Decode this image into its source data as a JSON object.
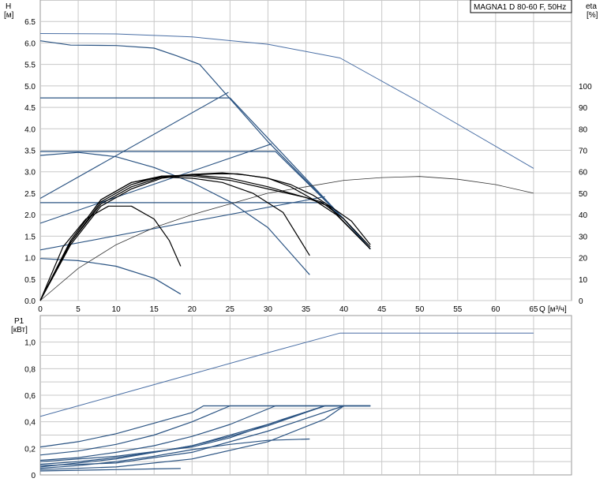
{
  "title": "MAGNA1 D 80-60 F, 50Hz",
  "chart_data": [
    {
      "type": "line",
      "name": "head-efficiency",
      "ylabel": "H",
      "yunit": "[м]",
      "y2label": "eta",
      "y2unit": "[%]",
      "xlabel": "Q",
      "xunit": "[м³/ч]",
      "xlim": [
        0,
        70
      ],
      "ylim": [
        0,
        7.0
      ],
      "y2lim": [
        0,
        140
      ],
      "xticks": [
        0,
        5,
        10,
        15,
        20,
        25,
        30,
        35,
        40,
        45,
        50,
        55,
        60,
        65
      ],
      "yticks": [
        0.0,
        0.5,
        1.0,
        1.5,
        2.0,
        2.5,
        3.0,
        3.5,
        4.0,
        4.5,
        5.0,
        5.5,
        6.0,
        6.5
      ],
      "y2ticks": [
        0,
        10,
        20,
        30,
        40,
        50,
        60,
        70,
        80,
        90,
        100
      ],
      "grid": true,
      "series": [
        {
          "curve": "head",
          "color": "#4a6fa5",
          "width": 1.0,
          "axis": "y",
          "points": [
            [
              0,
              6.22
            ],
            [
              10,
              6.21
            ],
            [
              20,
              6.14
            ],
            [
              30,
              5.97
            ],
            [
              39.5,
              5.65
            ],
            [
              50,
              4.62
            ],
            [
              65,
              3.08
            ]
          ]
        },
        {
          "curve": "head",
          "color": "#2a5382",
          "width": 1.2,
          "axis": "y",
          "points": [
            [
              0,
              6.05
            ],
            [
              4,
              5.95
            ],
            [
              10,
              5.94
            ],
            [
              15,
              5.88
            ],
            [
              18,
              5.7
            ],
            [
              21,
              5.5
            ],
            [
              30,
              3.7
            ],
            [
              40,
              1.9
            ],
            [
              43.5,
              1.2
            ]
          ]
        },
        {
          "curve": "head",
          "color": "#2a5382",
          "width": 1.2,
          "axis": "y",
          "points": [
            [
              0,
              4.72
            ],
            [
              25,
              4.72
            ],
            [
              40,
              1.9
            ],
            [
              43.5,
              1.2
            ]
          ]
        },
        {
          "curve": "head",
          "color": "#2a5382",
          "width": 1.2,
          "axis": "y",
          "points": [
            [
              0,
              3.47
            ],
            [
              31,
              3.47
            ],
            [
              40,
              1.9
            ],
            [
              43.5,
              1.2
            ]
          ]
        },
        {
          "curve": "head",
          "color": "#2a5382",
          "width": 1.2,
          "axis": "y",
          "points": [
            [
              0,
              2.28
            ],
            [
              37.5,
              2.28
            ],
            [
              40,
              1.9
            ],
            [
              43.5,
              1.2
            ]
          ]
        },
        {
          "curve": "head",
          "color": "#2a5382",
          "width": 1.2,
          "axis": "y",
          "points": [
            [
              0,
              3.38
            ],
            [
              5,
              3.45
            ],
            [
              10,
              3.35
            ],
            [
              15,
              3.1
            ],
            [
              20,
              2.75
            ],
            [
              25,
              2.3
            ],
            [
              30,
              1.7
            ],
            [
              35.5,
              0.6
            ]
          ]
        },
        {
          "curve": "head",
          "color": "#2a5382",
          "width": 1.2,
          "axis": "y",
          "points": [
            [
              0,
              0.98
            ],
            [
              5,
              0.93
            ],
            [
              10,
              0.8
            ],
            [
              15,
              0.52
            ],
            [
              18.5,
              0.15
            ]
          ]
        },
        {
          "curve": "system",
          "color": "#2a5382",
          "width": 1.1,
          "axis": "y",
          "points": [
            [
              0,
              2.38
            ],
            [
              24.8,
              4.85
            ]
          ]
        },
        {
          "curve": "system",
          "color": "#2a5382",
          "width": 1.1,
          "axis": "y",
          "points": [
            [
              0,
              1.8
            ],
            [
              30.5,
              3.65
            ]
          ]
        },
        {
          "curve": "system",
          "color": "#2a5382",
          "width": 1.1,
          "axis": "y",
          "points": [
            [
              0,
              1.18
            ],
            [
              37.5,
              2.42
            ]
          ]
        },
        {
          "curve": "efficiency",
          "color": "#333333",
          "width": 0.8,
          "axis": "y2",
          "points": [
            [
              0,
              0
            ],
            [
              5,
              15
            ],
            [
              10,
              26
            ],
            [
              15,
              34
            ],
            [
              20,
              40
            ],
            [
              25,
              45
            ],
            [
              30,
              50
            ],
            [
              35,
              53
            ],
            [
              40,
              56
            ],
            [
              45,
              57.3
            ],
            [
              50,
              57.8
            ],
            [
              55,
              56.5
            ],
            [
              60,
              54
            ],
            [
              65,
              50
            ]
          ]
        },
        {
          "curve": "efficiency",
          "color": "#000000",
          "width": 1.2,
          "axis": "y2",
          "points": [
            [
              0,
              0
            ],
            [
              4,
              26
            ],
            [
              8,
              44
            ],
            [
              12,
              52
            ],
            [
              16,
              57
            ],
            [
              20,
              58.5
            ],
            [
              23,
              59
            ],
            [
              26,
              59
            ],
            [
              30,
              57
            ],
            [
              33,
              54
            ],
            [
              36,
              49
            ],
            [
              39,
              42
            ],
            [
              41,
              37
            ],
            [
              43.5,
              26
            ]
          ]
        },
        {
          "curve": "efficiency",
          "color": "#000000",
          "width": 1.2,
          "axis": "y2",
          "points": [
            [
              0,
              0
            ],
            [
              4,
              27
            ],
            [
              8,
              45
            ],
            [
              12,
              53
            ],
            [
              16,
              57.5
            ],
            [
              20,
              58.8
            ],
            [
              24,
              59.5
            ],
            [
              27,
              58.5
            ],
            [
              30,
              57
            ],
            [
              33,
              53
            ],
            [
              36,
              47
            ],
            [
              39,
              40
            ],
            [
              43.5,
              24
            ]
          ]
        },
        {
          "curve": "efficiency",
          "color": "#000000",
          "width": 1.2,
          "axis": "y2",
          "points": [
            [
              0,
              0
            ],
            [
              4,
              27
            ],
            [
              8,
              46
            ],
            [
              12,
              54
            ],
            [
              16,
              58
            ],
            [
              20,
              58.5
            ],
            [
              25,
              57
            ],
            [
              30,
              53
            ],
            [
              34,
              49
            ],
            [
              37,
              46
            ],
            [
              40,
              38
            ],
            [
              43.5,
              25
            ]
          ]
        },
        {
          "curve": "efficiency",
          "color": "#000000",
          "width": 1.2,
          "axis": "y2",
          "points": [
            [
              0,
              0
            ],
            [
              4,
              28
            ],
            [
              8,
              47
            ],
            [
              12,
              55
            ],
            [
              16,
              58
            ],
            [
              20,
              58
            ],
            [
              25,
              56
            ],
            [
              30,
              52
            ],
            [
              35,
              48
            ],
            [
              38,
              44
            ],
            [
              43.5,
              24
            ]
          ]
        },
        {
          "curve": "efficiency",
          "color": "#000000",
          "width": 1.2,
          "axis": "y2",
          "points": [
            [
              0,
              0
            ],
            [
              4,
              28
            ],
            [
              8,
              47
            ],
            [
              12,
              55
            ],
            [
              16,
              57.5
            ],
            [
              20,
              57
            ],
            [
              24,
              55
            ],
            [
              28,
              50
            ],
            [
              32,
              41
            ],
            [
              35.5,
              21
            ]
          ]
        },
        {
          "curve": "efficiency",
          "color": "#000000",
          "width": 1.2,
          "axis": "y2",
          "points": [
            [
              0,
              0
            ],
            [
              3,
              25
            ],
            [
              6,
              38
            ],
            [
              9,
              44
            ],
            [
              12,
              44
            ],
            [
              15,
              38
            ],
            [
              17,
              28
            ],
            [
              18.5,
              16
            ]
          ]
        }
      ]
    },
    {
      "type": "line",
      "name": "power",
      "ylabel": "P1",
      "yunit": "[кВт]",
      "xlim": [
        0,
        70
      ],
      "ylim": [
        0,
        1.2
      ],
      "yticks": [
        0,
        0.2,
        0.4,
        0.6,
        0.8,
        1.0
      ],
      "ytick_labels": [
        "0",
        "0,2",
        "0,4",
        "0,6",
        "0,8",
        "1,0"
      ],
      "grid": true,
      "series": [
        {
          "curve": "power",
          "color": "#4a6fa5",
          "width": 1.0,
          "points": [
            [
              0,
              0.44
            ],
            [
              10,
              0.6
            ],
            [
              20,
              0.76
            ],
            [
              30,
              0.92
            ],
            [
              39.5,
              1.068
            ],
            [
              50,
              1.068
            ],
            [
              65,
              1.068
            ]
          ]
        },
        {
          "curve": "power",
          "color": "#2a5382",
          "width": 1.2,
          "points": [
            [
              0,
              0.21
            ],
            [
              5,
              0.25
            ],
            [
              10,
              0.31
            ],
            [
              15,
              0.39
            ],
            [
              20,
              0.47
            ],
            [
              21.5,
              0.52
            ],
            [
              43.5,
              0.52
            ]
          ]
        },
        {
          "curve": "power",
          "color": "#2a5382",
          "width": 1.2,
          "points": [
            [
              0,
              0.15
            ],
            [
              5,
              0.18
            ],
            [
              10,
              0.23
            ],
            [
              15,
              0.3
            ],
            [
              20,
              0.4
            ],
            [
              25,
              0.52
            ],
            [
              43.5,
              0.52
            ]
          ]
        },
        {
          "curve": "power",
          "color": "#2a5382",
          "width": 1.2,
          "points": [
            [
              0,
              0.11
            ],
            [
              5,
              0.13
            ],
            [
              10,
              0.17
            ],
            [
              15,
              0.22
            ],
            [
              20,
              0.29
            ],
            [
              25,
              0.38
            ],
            [
              31,
              0.52
            ],
            [
              43.5,
              0.52
            ]
          ]
        },
        {
          "curve": "power",
          "color": "#2a5382",
          "width": 1.2,
          "points": [
            [
              0,
              0.08
            ],
            [
              5,
              0.1
            ],
            [
              10,
              0.13
            ],
            [
              15,
              0.17
            ],
            [
              20,
              0.22
            ],
            [
              25,
              0.29
            ],
            [
              30,
              0.37
            ],
            [
              37.5,
              0.52
            ],
            [
              43.5,
              0.52
            ]
          ]
        },
        {
          "curve": "power",
          "color": "#2a5382",
          "width": 1.2,
          "points": [
            [
              0,
              0.06
            ],
            [
              10,
              0.12
            ],
            [
              20,
              0.22
            ],
            [
              30,
              0.38
            ],
            [
              37.5,
              0.52
            ],
            [
              43.5,
              0.52
            ]
          ]
        },
        {
          "curve": "power",
          "color": "#2a5382",
          "width": 1.2,
          "points": [
            [
              0,
              0.1
            ],
            [
              10,
              0.14
            ],
            [
              20,
              0.21
            ],
            [
              25,
              0.28
            ],
            [
              32,
              0.42
            ],
            [
              37.5,
              0.52
            ]
          ]
        },
        {
          "curve": "power",
          "color": "#2a5382",
          "width": 1.2,
          "points": [
            [
              0,
              0.05
            ],
            [
              5,
              0.07
            ],
            [
              10,
              0.1
            ],
            [
              15,
              0.14
            ],
            [
              20,
              0.19
            ],
            [
              25,
              0.23
            ],
            [
              30,
              0.26
            ],
            [
              35.5,
              0.27
            ]
          ]
        },
        {
          "curve": "power",
          "color": "#2a5382",
          "width": 1.2,
          "points": [
            [
              0,
              0.03
            ],
            [
              5,
              0.035
            ],
            [
              10,
              0.04
            ],
            [
              15,
              0.045
            ],
            [
              18.5,
              0.048
            ]
          ]
        },
        {
          "curve": "power",
          "color": "#2a5382",
          "width": 1.2,
          "points": [
            [
              0,
              0.04
            ],
            [
              10,
              0.06
            ],
            [
              20,
              0.12
            ],
            [
              30,
              0.25
            ],
            [
              37.5,
              0.42
            ],
            [
              40,
              0.52
            ]
          ]
        },
        {
          "curve": "power",
          "color": "#2a5382",
          "width": 1.2,
          "points": [
            [
              0,
              0.07
            ],
            [
              10,
              0.09
            ],
            [
              20,
              0.17
            ],
            [
              30,
              0.33
            ],
            [
              40,
              0.52
            ]
          ]
        }
      ]
    }
  ]
}
